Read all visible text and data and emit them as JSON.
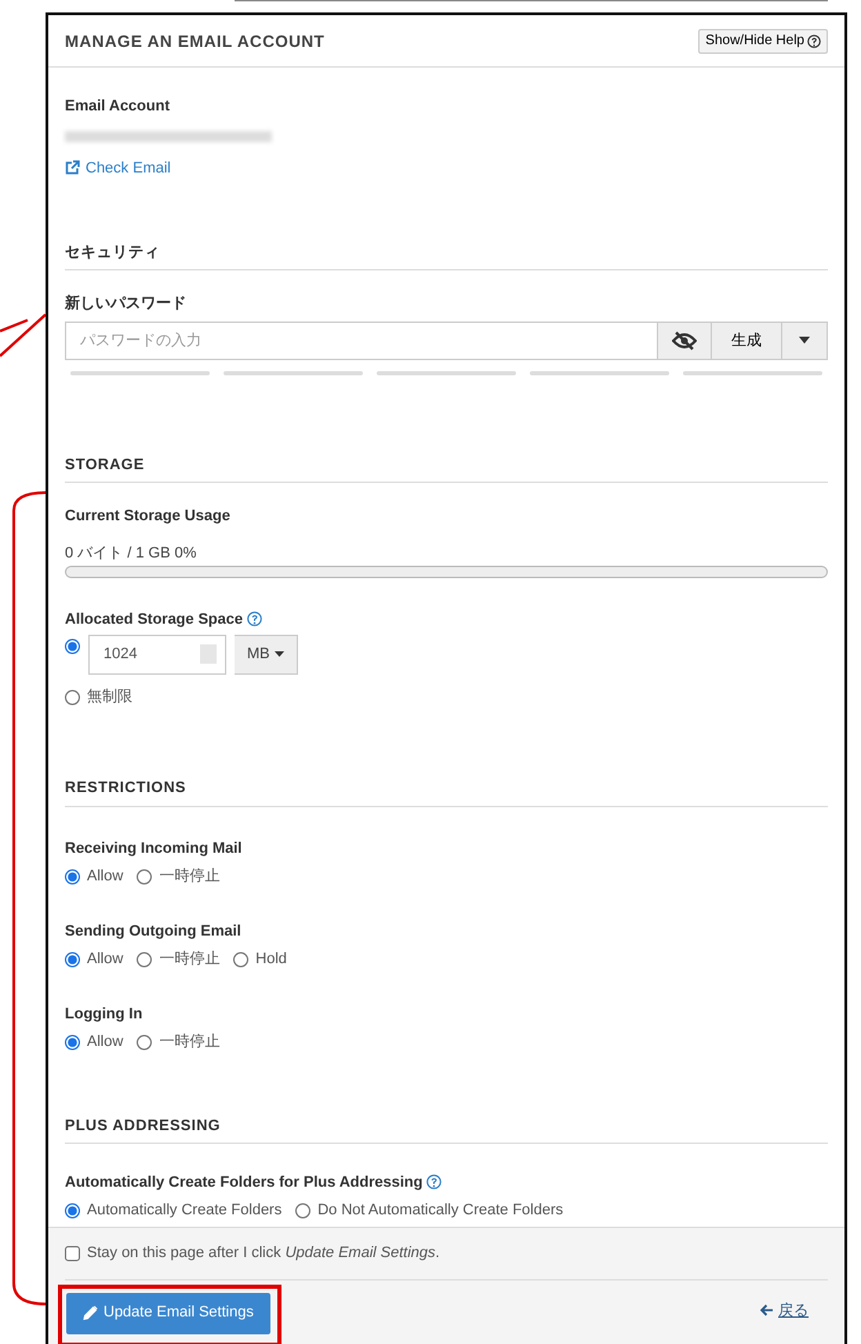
{
  "panel": {
    "title": "MANAGE AN EMAIL ACCOUNT",
    "help_button": "Show/Hide Help",
    "email_label": "Email Account",
    "check_email_link": "Check Email"
  },
  "security": {
    "heading": "セキュリティ",
    "password_label": "新しいパスワード",
    "password": {
      "placeholder": "パスワードの入力"
    },
    "generate_button": "生成"
  },
  "storage": {
    "heading": "STORAGE",
    "usage_label": "Current Storage Usage",
    "usage_text": "0 バイト / 1 GB 0%",
    "usage": {
      "level": 0
    },
    "allocated_label": "Allocated Storage Space",
    "options": [
      {
        "kind": "quota",
        "value": "1024",
        "unit": "MB",
        "selected": true
      },
      {
        "kind": "text",
        "label": "無制限",
        "selected": false
      }
    ]
  },
  "restrictions": {
    "heading": "RESTRICTIONS",
    "groups": [
      {
        "label": "Receiving Incoming Mail",
        "options": [
          {
            "label": "Allow",
            "selected": true
          },
          {
            "label": "一時停止",
            "selected": false
          }
        ]
      },
      {
        "label": "Sending Outgoing Email",
        "options": [
          {
            "label": "Allow",
            "selected": true
          },
          {
            "label": "一時停止",
            "selected": false
          },
          {
            "label": "Hold",
            "selected": false
          }
        ]
      },
      {
        "label": "Logging In",
        "options": [
          {
            "label": "Allow",
            "selected": true
          },
          {
            "label": "一時停止",
            "selected": false
          }
        ]
      }
    ]
  },
  "plus_addressing": {
    "heading": "PLUS ADDRESSING",
    "label": "Automatically Create Folders for Plus Addressing",
    "options": [
      {
        "label": "Automatically Create Folders",
        "selected": true
      },
      {
        "label": "Do Not Automatically Create Folders",
        "selected": false
      }
    ]
  },
  "footer": {
    "stay": {
      "text": "Stay on this page after I click *Update Email Settings*.",
      "checked": false
    },
    "submit_button": "Update Email Settings",
    "back_link": "戻る"
  }
}
